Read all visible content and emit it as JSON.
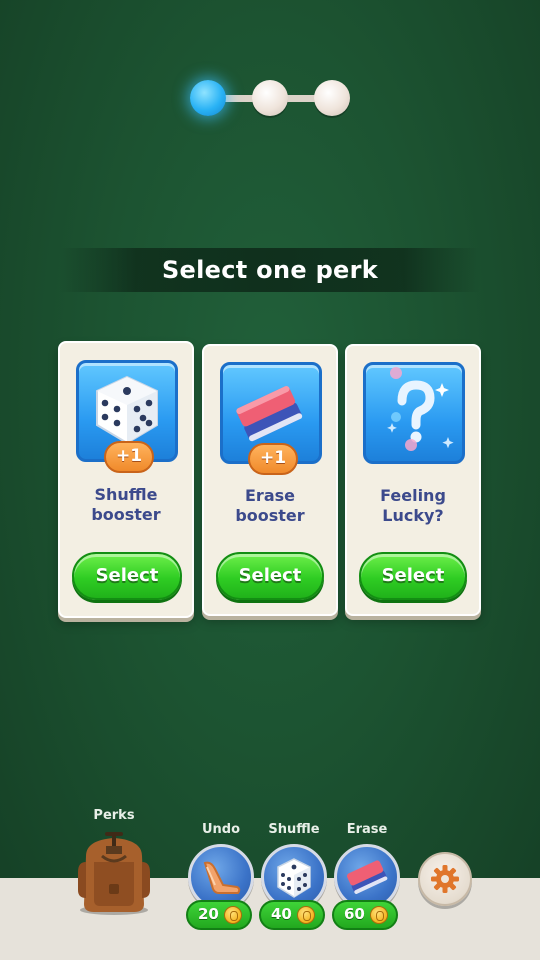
{
  "progress": {
    "total_steps": 3,
    "current_step": 1
  },
  "title": "Select one perk",
  "cards": [
    {
      "icon": "dice-icon",
      "badge": "+1",
      "name_line1": "Shuffle",
      "name_line2": "booster",
      "button": "Select"
    },
    {
      "icon": "eraser-icon",
      "badge": "+1",
      "name_line1": "Erase",
      "name_line2": "booster",
      "button": "Select"
    },
    {
      "icon": "question-mark-icon",
      "badge": "",
      "name_line1": "Feeling",
      "name_line2": "Lucky?",
      "button": "Select"
    }
  ],
  "bottom_bar": {
    "perks_label": "Perks",
    "boosters": [
      {
        "label": "Undo",
        "icon": "boomerang-icon",
        "cost": "20"
      },
      {
        "label": "Shuffle",
        "icon": "dice-icon",
        "cost": "40"
      },
      {
        "label": "Erase",
        "icon": "eraser-icon",
        "cost": "60"
      }
    ],
    "settings_icon": "gear-icon"
  },
  "colors": {
    "background": "#1c5331",
    "select_button": "#2fcd23",
    "tile_blue": "#2a9af1",
    "badge_orange": "#f08a2b",
    "perk_text": "#3c4a8c",
    "active_dot": "#29b2f5"
  }
}
